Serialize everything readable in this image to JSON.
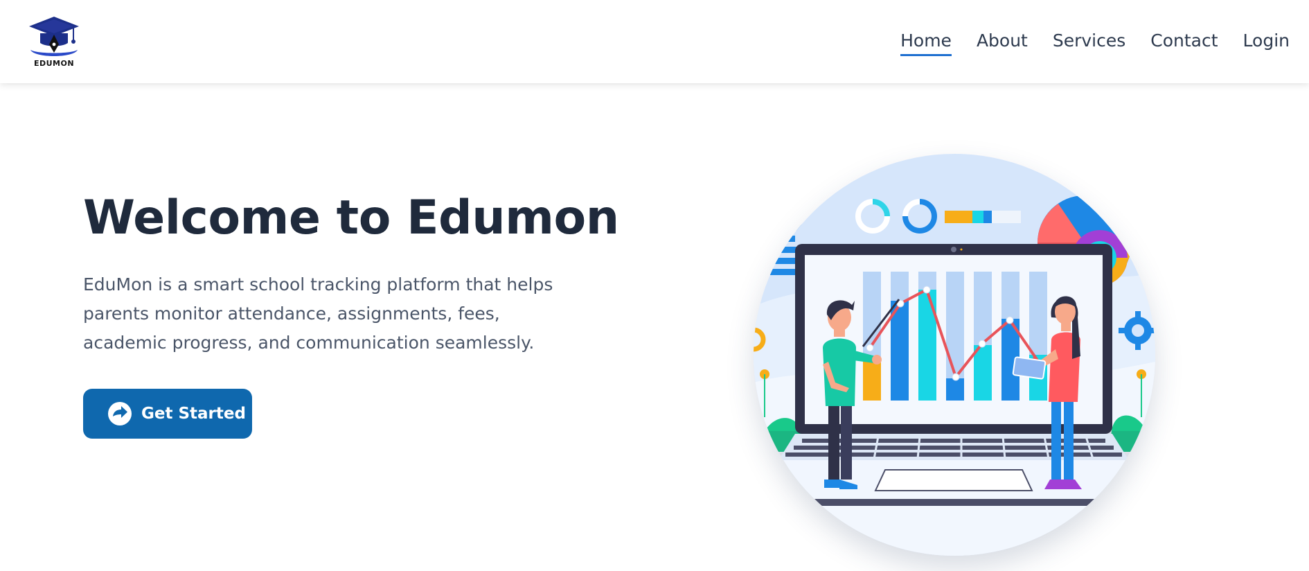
{
  "brand": {
    "name": "EDUMON",
    "icon": "graduation-cap-pen-icon",
    "colors": {
      "cap": "#1c2f8a",
      "accent": "#2a49c8",
      "pen": "#111111"
    }
  },
  "nav": {
    "items": [
      {
        "label": "Home",
        "active": true
      },
      {
        "label": "About",
        "active": false
      },
      {
        "label": "Services",
        "active": false
      },
      {
        "label": "Contact",
        "active": false
      },
      {
        "label": "Login",
        "active": false
      }
    ]
  },
  "hero": {
    "title": "Welcome to Edumon",
    "description": "EduMon is a smart school tracking platform that helps parents monitor attendance, assignments, fees, academic progress, and communication seamlessly.",
    "cta": {
      "label": "Get Started",
      "icon": "arrow-circle-right-icon",
      "color": "#0f68ae"
    }
  },
  "illustration": {
    "subject": "analytics-dashboard-illustration",
    "colors": {
      "background": "#d6e6fb",
      "bar_blue": "#1e88e5",
      "bar_cyan": "#19d6e5",
      "bar_orange": "#f7ad18",
      "line": "#e8545a"
    }
  }
}
